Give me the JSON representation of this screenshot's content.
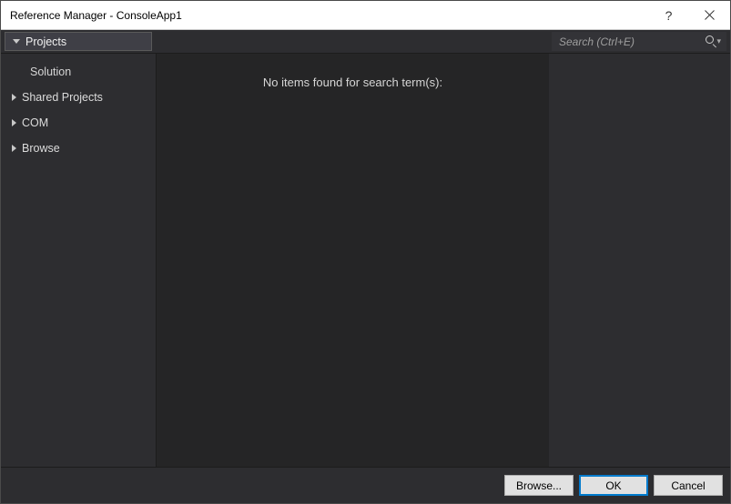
{
  "titlebar": {
    "title": "Reference Manager - ConsoleApp1",
    "help": "?"
  },
  "categories": {
    "selected": "Projects",
    "selected_sub": "Solution",
    "others": [
      "Shared Projects",
      "COM",
      "Browse"
    ]
  },
  "search": {
    "placeholder": "Search (Ctrl+E)"
  },
  "content": {
    "empty_message": "No items found for search term(s):"
  },
  "buttons": {
    "browse": "Browse...",
    "ok": "OK",
    "cancel": "Cancel"
  }
}
